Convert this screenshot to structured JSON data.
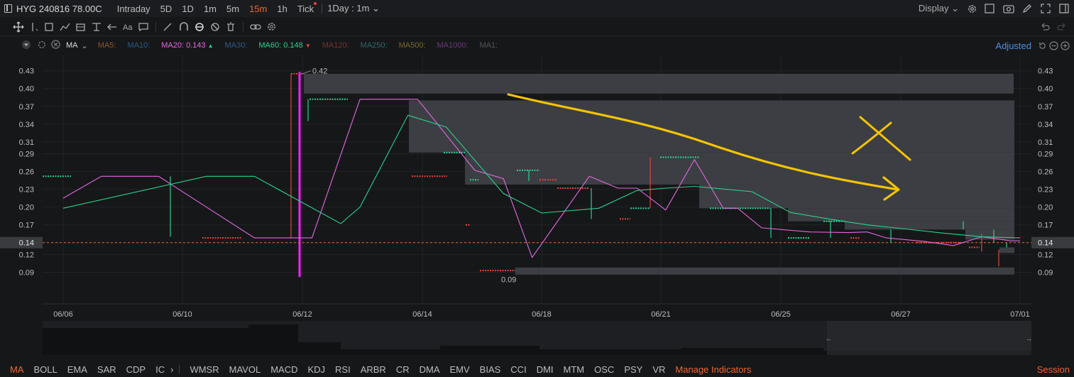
{
  "header": {
    "symbol": "HYG 240816 78.00C",
    "timeframes": [
      "Intraday",
      "5D",
      "1D",
      "1m",
      "5m",
      "15m",
      "1h",
      "Tick"
    ],
    "active_timeframe": "15m",
    "interval_dropdown": "1Day : 1m",
    "display_label": "Display"
  },
  "indicator_bar": {
    "name": "MA",
    "items": [
      {
        "label": "MA5:",
        "value": "",
        "color": "#8a5a2a"
      },
      {
        "label": "MA10:",
        "value": "",
        "color": "#2f5a85"
      },
      {
        "label": "MA20:",
        "value": "0.143",
        "color": "#e26ae0",
        "arrow": "▲",
        "arrow_color": "#2bd18c"
      },
      {
        "label": "MA30:",
        "value": "",
        "color": "#2f5a85"
      },
      {
        "label": "MA60:",
        "value": "0.148",
        "color": "#2bd18c",
        "arrow": "▼",
        "arrow_color": "#e0463c"
      },
      {
        "label": "MA120:",
        "value": "",
        "color": "#7a3232"
      },
      {
        "label": "MA250:",
        "value": "",
        "color": "#2a6a6a"
      },
      {
        "label": "MA500:",
        "value": "",
        "color": "#7a6a2a"
      },
      {
        "label": "MA1000:",
        "value": "",
        "color": "#6a3a7a"
      },
      {
        "label": "MA1:",
        "value": "",
        "color": "#555555"
      }
    ],
    "adjusted_label": "Adjusted"
  },
  "chart_data": {
    "type": "line",
    "x_ticks": [
      "06/06",
      "06/10",
      "06/12",
      "06/14",
      "06/18",
      "06/21",
      "06/25",
      "06/27",
      "07/01"
    ],
    "y_ticks": [
      "0.43",
      "0.40",
      "0.37",
      "0.34",
      "0.31",
      "0.29",
      "0.26",
      "0.23",
      "0.20",
      "0.17",
      "0.14",
      "0.12",
      "0.09"
    ],
    "ylim": [
      0.075,
      0.45
    ],
    "current_price": "0.14",
    "high_label": "0.42",
    "low_label": "0.09",
    "series": [
      {
        "name": "MA20",
        "color": "#e26ae0",
        "x": [
          0,
          0.4,
          1.0,
          2.0,
          2.6,
          3.1,
          3.7,
          4.3,
          4.6,
          4.9,
          5.5,
          5.8,
          6.0,
          6.3,
          6.6,
          6.9,
          7.05,
          7.3,
          7.8,
          8.2,
          8.4,
          8.6,
          8.8,
          9.0,
          9.3,
          9.6,
          9.9,
          10.0
        ],
        "y": [
          0.215,
          0.252,
          0.252,
          0.148,
          0.148,
          0.382,
          0.382,
          0.262,
          0.248,
          0.115,
          0.252,
          0.232,
          0.232,
          0.195,
          0.28,
          0.198,
          0.198,
          0.165,
          0.158,
          0.157,
          0.158,
          0.148,
          0.145,
          0.142,
          0.135,
          0.15,
          0.143,
          0.143
        ]
      },
      {
        "name": "MA60",
        "color": "#2bd18c",
        "x": [
          0,
          1.5,
          2.0,
          2.9,
          3.1,
          3.6,
          4.0,
          4.6,
          5.0,
          5.6,
          6.0,
          6.3,
          6.6,
          7.2,
          7.6,
          8.0,
          8.4,
          8.8,
          9.2,
          9.6,
          10.0
        ],
        "y": [
          0.198,
          0.252,
          0.252,
          0.172,
          0.2,
          0.355,
          0.335,
          0.223,
          0.19,
          0.198,
          0.228,
          0.232,
          0.235,
          0.226,
          0.191,
          0.18,
          0.17,
          0.163,
          0.156,
          0.15,
          0.148
        ]
      }
    ]
  },
  "bottom_bar": {
    "indicators": [
      "MA",
      "BOLL",
      "EMA",
      "SAR",
      "CDP",
      "IC",
      "WMSR",
      "MAVOL",
      "MACD",
      "KDJ",
      "RSI",
      "ARBR",
      "CR",
      "DMA",
      "EMV",
      "BIAS",
      "CCI",
      "DMI",
      "MTM",
      "OSC",
      "PSY",
      "VR"
    ],
    "active": "MA",
    "manage_label": "Manage Indicators",
    "session_label": "Session"
  }
}
